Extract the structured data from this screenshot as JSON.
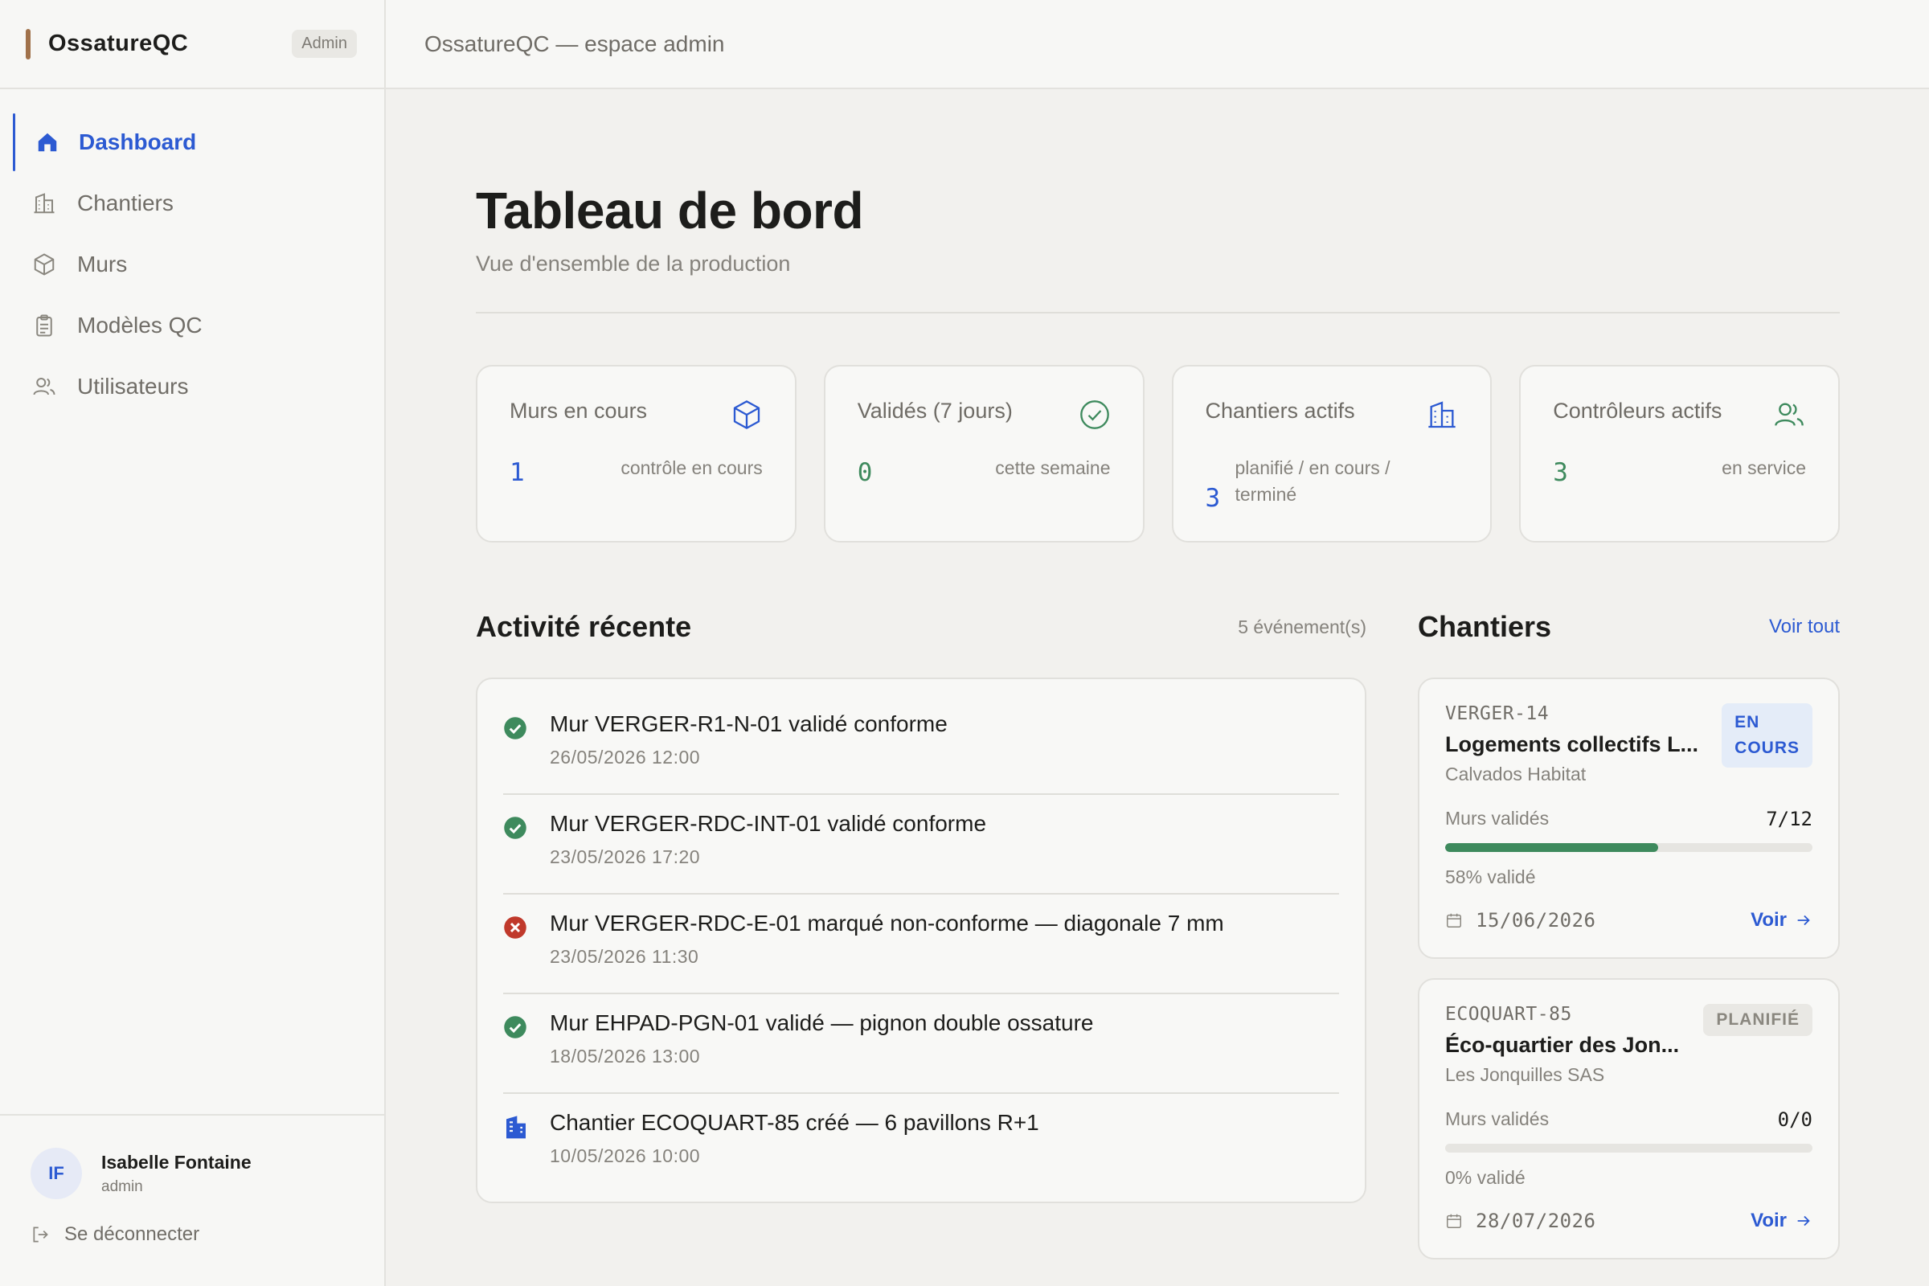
{
  "app": {
    "brand": "OssatureQC",
    "role_badge": "Admin",
    "topbar_title": "OssatureQC — espace admin"
  },
  "colors": {
    "accent": "#2c5ad2",
    "success": "#3e8a5d",
    "danger": "#c0392b",
    "brand_bar": "#a0714a"
  },
  "sidebar": {
    "items": [
      {
        "label": "Dashboard",
        "icon": "home-icon",
        "active": true
      },
      {
        "label": "Chantiers",
        "icon": "building-icon",
        "active": false
      },
      {
        "label": "Murs",
        "icon": "cube-icon",
        "active": false
      },
      {
        "label": "Modèles QC",
        "icon": "clipboard-icon",
        "active": false
      },
      {
        "label": "Utilisateurs",
        "icon": "users-icon",
        "active": false
      }
    ],
    "user": {
      "initials": "IF",
      "name": "Isabelle Fontaine",
      "role": "admin"
    },
    "logout_label": "Se déconnecter"
  },
  "page": {
    "title": "Tableau de bord",
    "subtitle": "Vue d'ensemble de la production"
  },
  "stats": [
    {
      "label": "Murs en cours",
      "value": "1",
      "note": "contrôle en cours",
      "icon": "cube-icon"
    },
    {
      "label": "Validés (7 jours)",
      "value": "0",
      "note": "cette semaine",
      "icon": "check-circle-icon"
    },
    {
      "label": "Chantiers actifs",
      "value": "3",
      "note": "planifié / en cours / terminé",
      "icon": "building-icon"
    },
    {
      "label": "Contrôleurs actifs",
      "value": "3",
      "note": "en service",
      "icon": "users-icon"
    }
  ],
  "activity": {
    "title": "Activité récente",
    "count_label": "5 événement(s)",
    "items": [
      {
        "text": "Mur VERGER-R1-N-01 validé conforme",
        "time": "26/05/2026 12:00",
        "status": "ok"
      },
      {
        "text": "Mur VERGER-RDC-INT-01 validé conforme",
        "time": "23/05/2026 17:20",
        "status": "ok"
      },
      {
        "text": "Mur VERGER-RDC-E-01 marqué non-conforme — diagonale 7 mm",
        "time": "23/05/2026 11:30",
        "status": "error"
      },
      {
        "text": "Mur EHPAD-PGN-01 validé — pignon double ossature",
        "time": "18/05/2026 13:00",
        "status": "ok"
      },
      {
        "text": "Chantier ECOQUART-85 créé — 6 pavillons R+1",
        "time": "10/05/2026 10:00",
        "status": "created"
      }
    ]
  },
  "projects": {
    "title": "Chantiers",
    "see_all": "Voir tout",
    "walls_label": "Murs validés",
    "view_label": "Voir",
    "items": [
      {
        "code": "VERGER-14",
        "name": "Logements collectifs L...",
        "client": "Calvados Habitat",
        "badge_line1": "EN",
        "badge_line2": "COURS",
        "badge_type": "blue",
        "count": "7/12",
        "progress": 0.58,
        "pct_label": "58% validé",
        "date": "15/06/2026"
      },
      {
        "code": "ECOQUART-85",
        "name": "Éco-quartier des Jon...",
        "client": "Les Jonquilles SAS",
        "badge_line1": "PLANIFIÉ",
        "badge_line2": "",
        "badge_type": "grey",
        "count": "0/0",
        "progress": 0,
        "pct_label": "0% validé",
        "date": "28/07/2026"
      }
    ]
  }
}
